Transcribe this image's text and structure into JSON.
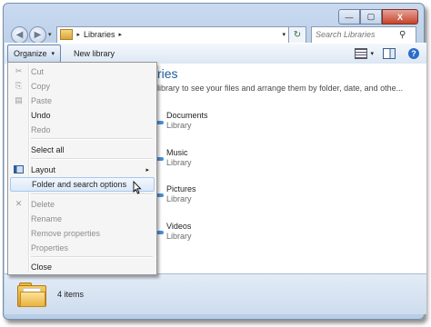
{
  "window": {
    "minimize_glyph": "—",
    "maximize_glyph": "▢",
    "close_glyph": "X"
  },
  "address_bar": {
    "breadcrumb": [
      "Libraries"
    ],
    "separator": "▸",
    "dropdown": "▾",
    "refresh": "↻"
  },
  "nav": {
    "back": "◀",
    "forward": "▶",
    "dropdown": "▾"
  },
  "search": {
    "placeholder": "Search Libraries",
    "icon": "⚲"
  },
  "toolbar": {
    "organize_label": "Organize",
    "organize_dd": "▾",
    "new_library_label": "New library",
    "view_dd": "▾",
    "help_label": "?"
  },
  "content": {
    "header_partial": "ries",
    "subtitle_partial": "library to see your files and arrange them by folder, date, and othe...",
    "libraries": [
      {
        "name": "Documents",
        "type": "Library"
      },
      {
        "name": "Music",
        "type": "Library"
      },
      {
        "name": "Pictures",
        "type": "Library"
      },
      {
        "name": "Videos",
        "type": "Library"
      }
    ]
  },
  "menu": {
    "items": [
      {
        "label": "Cut",
        "enabled": false,
        "icon": "scissors-icon",
        "glyph": "✂"
      },
      {
        "label": "Copy",
        "enabled": false,
        "icon": "copy-icon",
        "glyph": "⎘"
      },
      {
        "label": "Paste",
        "enabled": false,
        "icon": "paste-icon",
        "glyph": "▤"
      },
      {
        "label": "Undo",
        "enabled": true
      },
      {
        "label": "Redo",
        "enabled": false
      },
      {
        "label": "Select all",
        "enabled": true
      },
      {
        "label": "Layout",
        "enabled": true,
        "icon": "layout-icon",
        "submenu": "▸"
      },
      {
        "label": "Folder and search options",
        "enabled": true,
        "highlighted": true
      },
      {
        "label": "Delete",
        "enabled": false,
        "icon": "delete-icon",
        "glyph": "✕"
      },
      {
        "label": "Rename",
        "enabled": false
      },
      {
        "label": "Remove properties",
        "enabled": false
      },
      {
        "label": "Properties",
        "enabled": false
      },
      {
        "label": "Close",
        "enabled": true
      }
    ]
  },
  "status": {
    "count": "4 items"
  },
  "colors": {
    "header_blue": "#1e5b99",
    "highlight_border": "#a8c8ec",
    "disabled_text": "#8d8d8d"
  }
}
